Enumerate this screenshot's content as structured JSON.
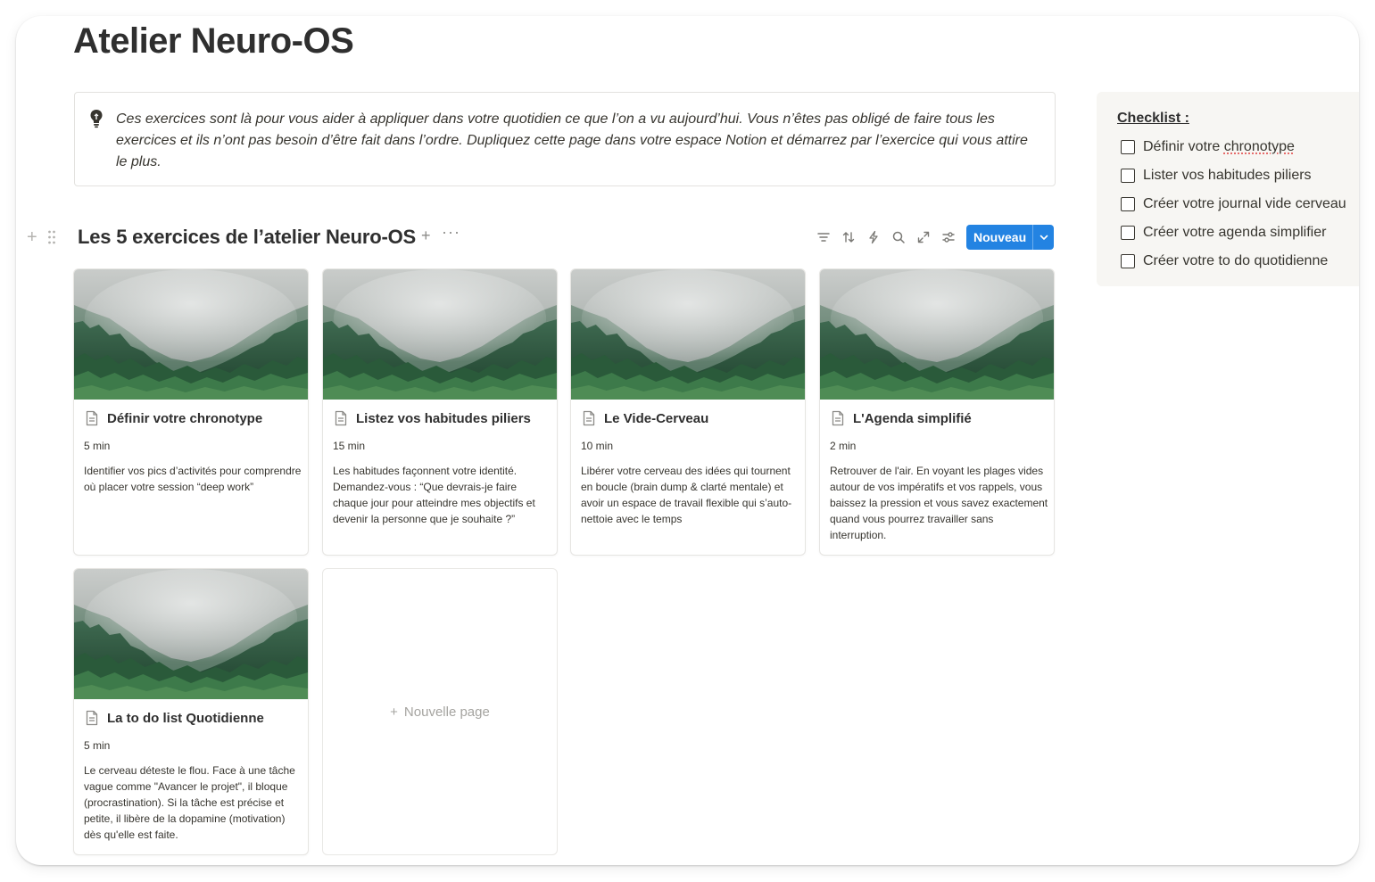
{
  "page": {
    "title": "Atelier Neuro-OS"
  },
  "callout": {
    "icon": "lightbulb-icon",
    "text": "Ces exercices sont là pour vous aider à appliquer dans votre quotidien ce que l’on a vu aujourd’hui. Vous n’êtes pas obligé de faire tous les exercices et ils n’ont pas besoin d’être fait dans l’ordre. Dupliquez cette page dans votre espace Notion et démarrez par l’exercice qui vous attire le plus."
  },
  "database": {
    "title": "Les 5 exercices de l’atelier Neuro-OS",
    "add_label": "+",
    "more_label": "···",
    "toolbar": [
      "filter-icon",
      "sort-icon",
      "automation-icon",
      "search-icon",
      "expand-icon",
      "settings-icon"
    ],
    "new_button_label": "Nouveau",
    "accent_color": "#2383e2",
    "new_page_plus": "+",
    "new_page_label": "Nouvelle page",
    "cards": [
      {
        "title": "Définir votre chronotype",
        "duration": "5 min",
        "description": "Identifier vos pics d’activités pour comprendre où placer votre session “deep work”"
      },
      {
        "title": "Listez vos habitudes piliers",
        "duration": "15 min",
        "description": "Les habitudes façonnent votre identité. Demandez-vous : “Que devrais-je faire chaque jour pour atteindre mes objectifs et devenir la personne que je souhaite ?”"
      },
      {
        "title": "Le Vide-Cerveau",
        "duration": "10 min",
        "description": "Libérer votre cerveau des idées qui tournent en boucle (brain dump & clarté mentale) et avoir un espace de travail flexible qui s’auto-nettoie avec le temps"
      },
      {
        "title": "L'Agenda simplifié",
        "duration": "2 min",
        "description": "Retrouver de l'air. En voyant les plages vides autour de vos impératifs et vos rappels, vous baissez la pression et vous savez exactement quand vous pourrez travailler sans interruption."
      },
      {
        "title": "La to do list Quotidienne",
        "duration": "5 min",
        "description": "Le cerveau déteste le flou. Face à une tâche vague comme \"Avancer le projet\", il bloque (procrastination). Si la tâche est précise et petite, il libère de la dopamine (motivation) dès qu'elle est faite."
      }
    ]
  },
  "checklist": {
    "title": "Checklist :",
    "items": [
      {
        "prefix": "Définir votre ",
        "flagged": "chronotype",
        "checked": false
      },
      {
        "prefix": "Lister vos habitudes piliers",
        "flagged": "",
        "checked": false
      },
      {
        "prefix": "Créer votre journal vide cerveau",
        "flagged": "",
        "checked": false
      },
      {
        "prefix": "Créer votre agenda simplifier",
        "flagged": "",
        "checked": false
      },
      {
        "prefix": "Créer votre to do quotidienne",
        "flagged": "",
        "checked": false
      }
    ]
  }
}
